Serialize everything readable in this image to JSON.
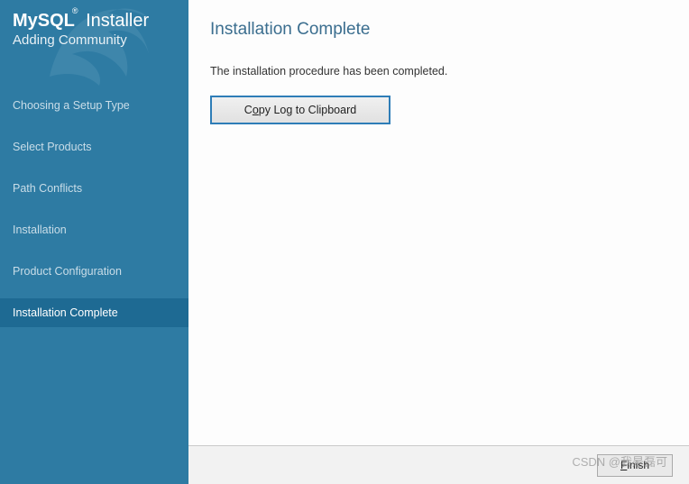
{
  "brand": {
    "name": "MySQL",
    "product": "Installer",
    "subtitle": "Adding Community"
  },
  "steps": [
    {
      "label": "Choosing a Setup Type",
      "active": false
    },
    {
      "label": "Select Products",
      "active": false
    },
    {
      "label": "Path Conflicts",
      "active": false
    },
    {
      "label": "Installation",
      "active": false
    },
    {
      "label": "Product Configuration",
      "active": false
    },
    {
      "label": "Installation Complete",
      "active": true
    }
  ],
  "page": {
    "title": "Installation Complete",
    "message": "The installation procedure has been completed.",
    "copy_pre": "C",
    "copy_u": "o",
    "copy_post": "py Log to Clipboard"
  },
  "footer": {
    "finish_u": "F",
    "finish_post": "inish"
  },
  "watermark": "CSDN @我是磊可"
}
